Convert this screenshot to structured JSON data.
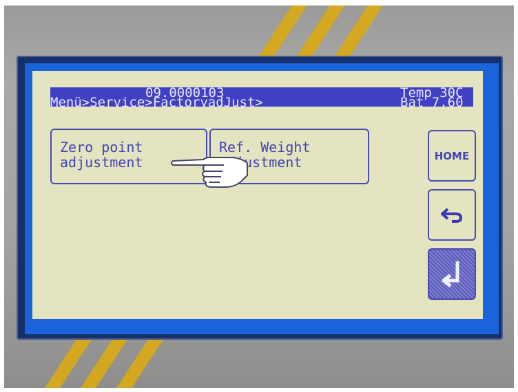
{
  "header": {
    "device_id": "09.0000103",
    "breadcrumb": "Menü>Service>FactoryadJust>",
    "temperature": "Temp 30C",
    "battery": "Bat 7.60"
  },
  "buttons": [
    {
      "line1": "Zero point",
      "line2": "adjustment"
    },
    {
      "line1": "Ref. Weight",
      "line2": "adjustment"
    }
  ],
  "side_buttons": {
    "home_label": "HOME",
    "back_icon": "back-arrow-icon",
    "enter_icon": "enter-arrow-icon"
  },
  "colors": {
    "lcd_background": "#e4e4c0",
    "header_bar": "#4040c4",
    "lcd_text": "#4444b4",
    "screen_frame": "#1a63d8",
    "stripe_accent": "#d7a91a"
  },
  "cursor_icon": "pointing-hand-icon"
}
